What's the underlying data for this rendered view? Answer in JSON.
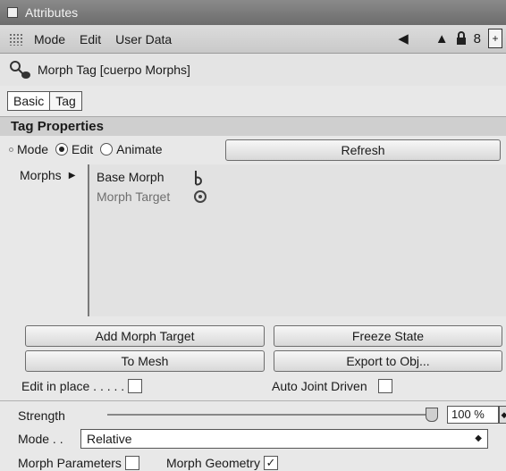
{
  "window": {
    "title": "Attributes"
  },
  "menu": {
    "items": [
      "Mode",
      "Edit",
      "User Data"
    ]
  },
  "toolbar": {
    "icons": [
      "back-arrow-icon",
      "up-arrow-icon",
      "lock-icon",
      "link-icon",
      "new-window-icon"
    ]
  },
  "object": {
    "name": "Morph Tag [cuerpo Morphs]"
  },
  "tabs": [
    {
      "label": "Basic",
      "active": true
    },
    {
      "label": "Tag",
      "active": false
    }
  ],
  "section": {
    "title": "Tag Properties"
  },
  "mode_row": {
    "label": "Mode",
    "options": [
      "Edit",
      "Animate"
    ],
    "selected": "Edit",
    "refresh_label": "Refresh"
  },
  "morphs": {
    "label": "Morphs",
    "items": [
      {
        "name": "Base Morph",
        "icon": "base-morph-icon"
      },
      {
        "name": "Morph Target",
        "icon": "target-icon"
      }
    ]
  },
  "buttons": {
    "add_morph_target": "Add Morph Target",
    "freeze_state": "Freeze State",
    "to_mesh": "To Mesh",
    "export_to_obj": "Export to Obj..."
  },
  "options": {
    "edit_in_place": {
      "label": "Edit in place . . . . .",
      "checked": false
    },
    "auto_joint_driven": {
      "label": "Auto Joint Driven",
      "checked": false
    }
  },
  "strength": {
    "label": "Strength",
    "value": "100 %",
    "level": 1.0
  },
  "mode2": {
    "label": "Mode . .",
    "value": "Relative"
  },
  "params": {
    "morph_parameters": {
      "label": "Morph Parameters",
      "checked": false
    },
    "morph_geometry": {
      "label": "Morph Geometry",
      "checked": true,
      "mark": "✓"
    }
  }
}
